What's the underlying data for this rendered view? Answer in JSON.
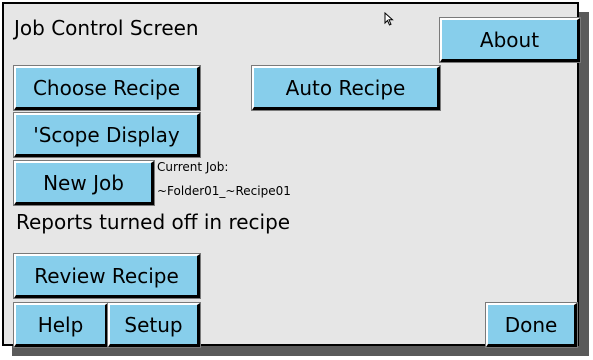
{
  "screen": {
    "title": "Job Control Screen"
  },
  "buttons": {
    "about": "About",
    "choose_recipe": "Choose Recipe",
    "auto_recipe": "Auto Recipe",
    "scope_display": "'Scope Display",
    "new_job": "New Job",
    "review_recipe": "Review Recipe",
    "help": "Help",
    "setup": "Setup",
    "done": "Done"
  },
  "job": {
    "current_label": "Current Job:",
    "current_value": "~Folder01_~Recipe01"
  },
  "status_text": "Reports turned off in recipe",
  "colors": {
    "button_fill": "#87ceeb",
    "panel_background": "#e6e6e6",
    "drop_shadow": "#5a5a5a"
  },
  "icons": {
    "cursor": "mouse-pointer-icon"
  }
}
